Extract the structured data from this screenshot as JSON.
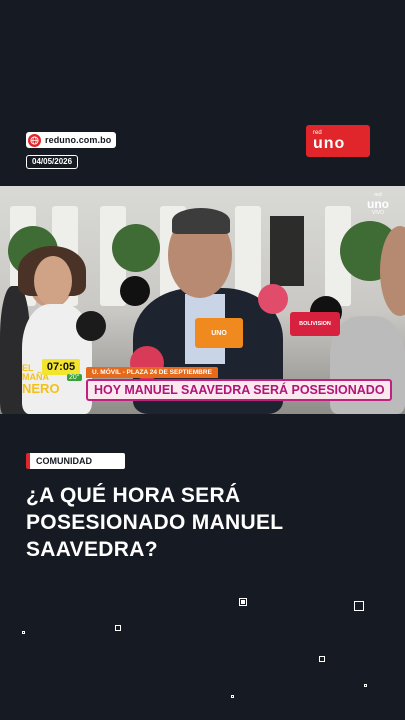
{
  "header": {
    "site_url": "reduno.com.bo",
    "date": "04/05/2026",
    "brand_small": "red",
    "brand_main": "uno"
  },
  "video": {
    "channel_small": "red",
    "channel_main": "uno",
    "live_label": "VIVO",
    "time": "07:05",
    "temperature": "20°",
    "show_logo_line1": "EL",
    "show_logo_line2": "MAÑA",
    "show_logo_line3": "NERO",
    "lower_third_subtitle": "U. MÓVIL - PLAZA 24 DE SEPTIEMBRE",
    "lower_third_title": "HOY MANUEL SAAVEDRA SERÁ POSESIONADO",
    "mic_label_1": "UNO",
    "mic_label_2": "BOLIVISION"
  },
  "article": {
    "category": "COMUNIDAD",
    "headline": "¿A QUÉ HORA SERÁ POSESIONADO MANUEL SAAVEDRA?"
  },
  "colors": {
    "background": "#161a22",
    "accent_red": "#e0262a",
    "lower_third_pink": "#c1207f",
    "clock_yellow": "#f3e52d"
  }
}
